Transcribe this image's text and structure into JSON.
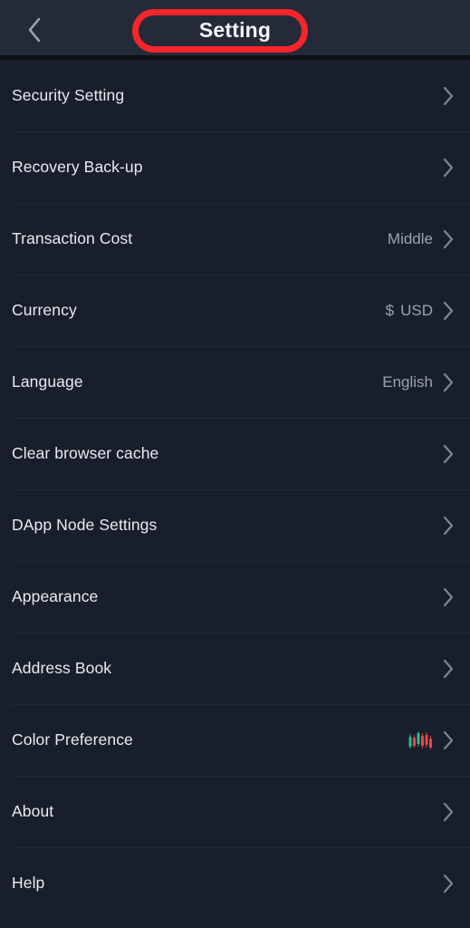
{
  "header": {
    "title": "Setting",
    "back_icon": "chevron-left-icon",
    "annotation_color": "#f4262b",
    "background": "#252a38"
  },
  "theme": {
    "page_background": "#191e2b",
    "label_color": "#e8ebf1",
    "value_color": "#9aa3b3",
    "divider_color": "#232936",
    "candle_up_color": "#27c08a",
    "candle_down_color": "#e8474b"
  },
  "list": {
    "rows": [
      {
        "label": "Security Setting",
        "value": "",
        "accessory": "chevron-right-icon"
      },
      {
        "label": "Recovery Back-up",
        "value": "",
        "accessory": "chevron-right-icon"
      },
      {
        "label": "Transaction Cost",
        "value": "Middle",
        "accessory": "chevron-right-icon"
      },
      {
        "label": "Currency",
        "value": "$ USD",
        "currency_symbol": "$",
        "currency_code": "USD",
        "accessory": "chevron-right-icon"
      },
      {
        "label": "Language",
        "value": "English",
        "accessory": "chevron-right-icon"
      },
      {
        "label": "Clear browser cache",
        "value": "",
        "accessory": "chevron-right-icon"
      },
      {
        "label": "DApp Node Settings",
        "value": "",
        "accessory": "chevron-right-icon"
      },
      {
        "label": "Appearance",
        "value": "",
        "accessory": "chevron-right-icon"
      },
      {
        "label": "Address Book",
        "value": "",
        "accessory": "chevron-right-icon"
      },
      {
        "label": "Color Preference",
        "value": "",
        "icon": "candlestick-chart-icon",
        "accessory": "chevron-right-icon"
      },
      {
        "label": "About",
        "value": "",
        "accessory": "chevron-right-icon"
      },
      {
        "label": "Help",
        "value": "",
        "accessory": "chevron-right-icon"
      }
    ]
  }
}
